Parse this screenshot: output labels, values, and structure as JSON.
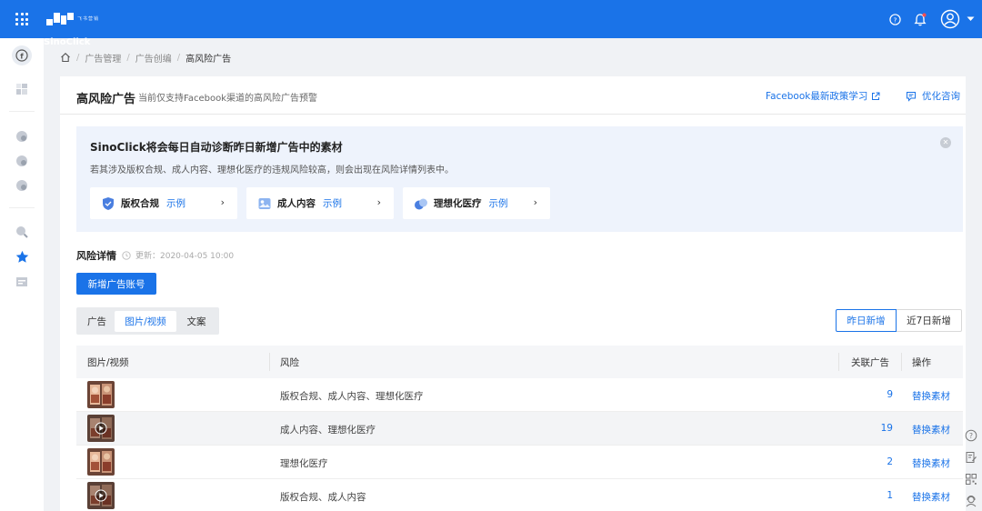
{
  "app": {
    "logo_text": "SinoClick",
    "logo_sub": "飞书营销"
  },
  "breadcrumb": [
    "广告管理",
    "广告创编",
    "高风险广告"
  ],
  "header": {
    "title": "高风险广告",
    "description": "当前仅支持Facebook渠道的高风险广告预警",
    "fb_link": "Facebook最新政策学习",
    "consult_link": "优化咨询"
  },
  "banner": {
    "title": "SinoClick将会每日自动诊断昨日新增广告中的素材",
    "description": "若其涉及版权合规、成人内容、理想化医疗的违规风险较高，则会出现在风险详情列表中。",
    "cards": [
      {
        "name": "版权合规",
        "link": "示例"
      },
      {
        "name": "成人内容",
        "link": "示例"
      },
      {
        "name": "理想化医疗",
        "link": "示例"
      }
    ]
  },
  "details": {
    "title": "风险详情",
    "update_time": "更新：2020-04-05 10:00",
    "add_button": "新增广告账号"
  },
  "tabs": [
    {
      "label": "广告",
      "active": false
    },
    {
      "label": "图片/视频",
      "active": true
    },
    {
      "label": "文案",
      "active": false
    }
  ],
  "range_toggle": [
    {
      "label": "昨日新增",
      "active": true
    },
    {
      "label": "近7日新增",
      "active": false
    }
  ],
  "table": {
    "columns": [
      "图片/视频",
      "风险",
      "关联广告",
      "操作"
    ],
    "rows": [
      {
        "media": "image",
        "risk": "版权合规、成人内容、理想化医疗",
        "count": "9",
        "action": "替换素材"
      },
      {
        "media": "video",
        "risk": "成人内容、理想化医疗",
        "count": "19",
        "action": "替换素材"
      },
      {
        "media": "image",
        "risk": "理想化医疗",
        "count": "2",
        "action": "替换素材"
      },
      {
        "media": "video",
        "risk": "版权合规、成人内容",
        "count": "1",
        "action": "替换素材"
      }
    ]
  },
  "colors": {
    "primary": "#1a73e8",
    "banner_bg": "#eef3fc",
    "page_bg": "#f0f2f5"
  }
}
